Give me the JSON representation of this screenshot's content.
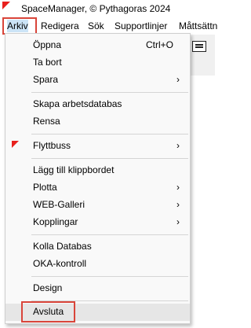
{
  "window": {
    "title": "SpaceManager, © Pythagoras  2024",
    "icon": "app-flag-icon"
  },
  "menubar": {
    "items": [
      "Arkiv",
      "Redigera",
      "Sök",
      "Supportlinjer",
      "Måttsättn"
    ],
    "active": "Arkiv"
  },
  "menu": {
    "items": [
      {
        "label": "Öppna",
        "shortcut": "Ctrl+O"
      },
      {
        "label": "Ta bort"
      },
      {
        "label": "Spara",
        "submenu": true
      },
      {
        "label": "Skapa arbetsdatabas"
      },
      {
        "label": "Rensa"
      },
      {
        "label": "Flyttbuss",
        "submenu": true
      },
      {
        "label": "Lägg till klippbordet"
      },
      {
        "label": "Plotta",
        "submenu": true
      },
      {
        "label": "WEB-Galleri",
        "submenu": true
      },
      {
        "label": "Kopplingar",
        "submenu": true
      },
      {
        "label": "Kolla Databas"
      },
      {
        "label": "OKA-kontroll"
      },
      {
        "label": "Design"
      },
      {
        "label": "Avsluta"
      }
    ],
    "submenu_glyph": "›"
  },
  "colors": {
    "highlight_border": "#d9453a",
    "menu_bg": "#f9f9f9",
    "hover_bg": "#e6e6e6",
    "flag_red": "#e8201c"
  }
}
